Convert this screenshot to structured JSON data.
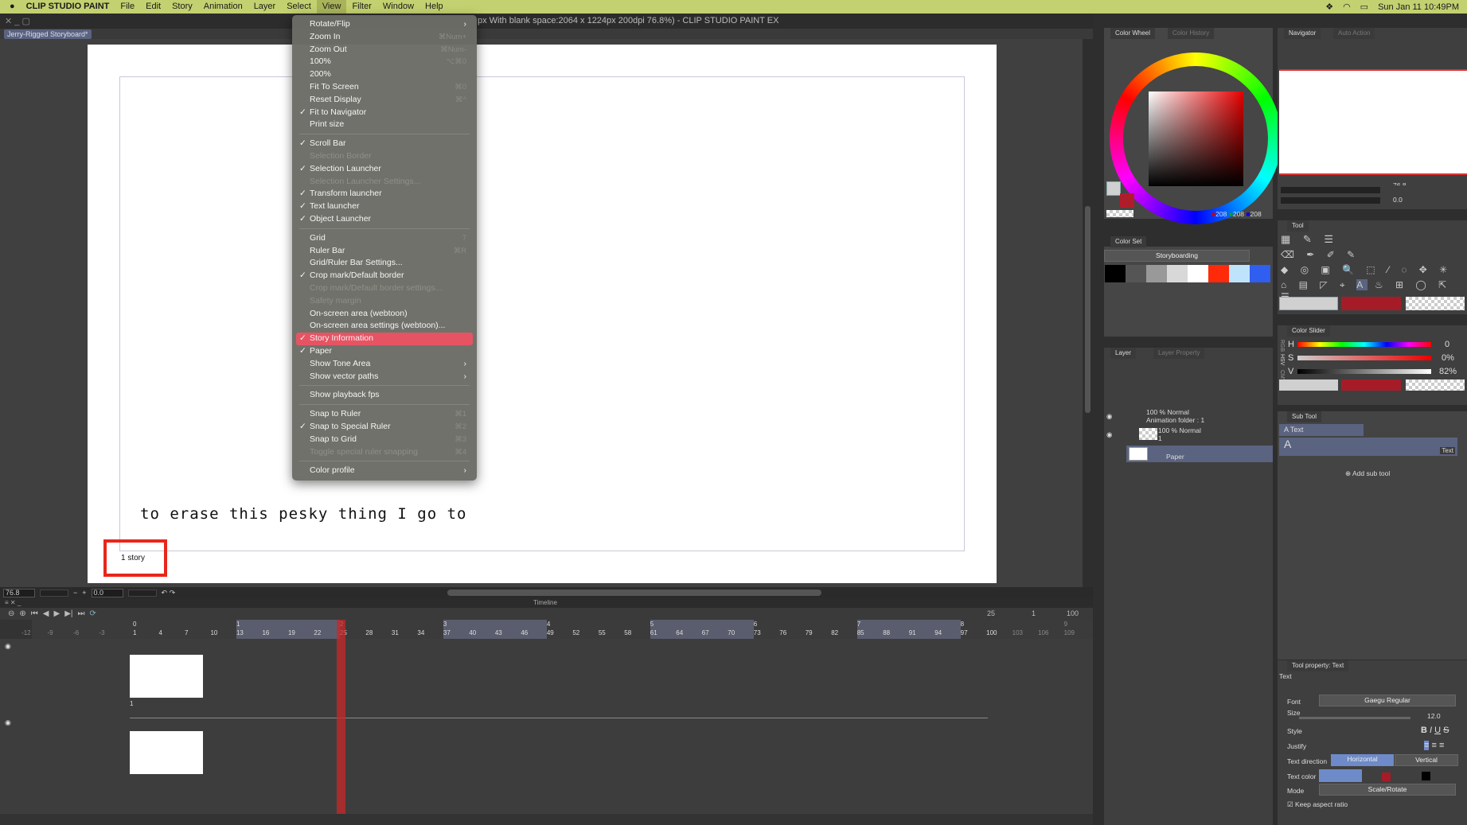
{
  "menubar": {
    "app": "CLIP STUDIO PAINT",
    "items": [
      "File",
      "Edit",
      "Story",
      "Animation",
      "Layer",
      "Select",
      "View",
      "Filter",
      "Window",
      "Help"
    ],
    "active": "View",
    "clock": "Sun Jan 11  10:49PM"
  },
  "window": {
    "title": "px With blank space:2064 x 1224px 200dpi 76.8%)  - CLIP STUDIO PAINT EX",
    "doc_tab": "Jerry-Rigged Storyboard*"
  },
  "canvas": {
    "text": "to erase this pesky thing I go to",
    "story_label": "1 story"
  },
  "status": {
    "zoom": "76.8",
    "angle": "0.0"
  },
  "view_menu": [
    {
      "label": "Rotate/Flip",
      "submenu": true
    },
    {
      "label": "Zoom In",
      "shortcut": "⌘Num+"
    },
    {
      "label": "Zoom Out",
      "shortcut": "⌘Num-"
    },
    {
      "label": "100%",
      "shortcut": "⌥⌘0"
    },
    {
      "label": "200%"
    },
    {
      "label": "Fit To Screen",
      "shortcut": "⌘0"
    },
    {
      "label": "Reset Display",
      "shortcut": "⌘^"
    },
    {
      "label": "Fit to Navigator",
      "checked": true
    },
    {
      "label": "Print size"
    },
    {
      "sep": true
    },
    {
      "label": "Scroll Bar",
      "checked": true
    },
    {
      "label": "Selection Border",
      "disabled": true
    },
    {
      "label": "Selection Launcher",
      "checked": true
    },
    {
      "label": "Selection Launcher Settings...",
      "disabled": true
    },
    {
      "label": "Transform launcher",
      "checked": true
    },
    {
      "label": "Text launcher",
      "checked": true
    },
    {
      "label": "Object Launcher",
      "checked": true
    },
    {
      "sep": true
    },
    {
      "label": "Grid",
      "shortcut": "7"
    },
    {
      "label": "Ruler Bar",
      "shortcut": "⌘R"
    },
    {
      "label": "Grid/Ruler Bar Settings..."
    },
    {
      "label": "Crop mark/Default border",
      "checked": true
    },
    {
      "label": "Crop mark/Default border settings...",
      "disabled": true
    },
    {
      "label": "Safety margin",
      "disabled": true
    },
    {
      "label": "On-screen area (webtoon)"
    },
    {
      "label": "On-screen area settings (webtoon)..."
    },
    {
      "label": "Story Information",
      "checked": true,
      "highlighted": true
    },
    {
      "label": "Paper",
      "checked": true
    },
    {
      "label": "Show Tone Area",
      "submenu": true
    },
    {
      "label": "Show vector paths",
      "submenu": true
    },
    {
      "sep": true
    },
    {
      "label": "Show playback fps"
    },
    {
      "sep": true
    },
    {
      "label": "Snap to Ruler",
      "shortcut": "⌘1"
    },
    {
      "label": "Snap to Special Ruler",
      "checked": true,
      "shortcut": "⌘2"
    },
    {
      "label": "Snap to Grid",
      "shortcut": "⌘3"
    },
    {
      "label": "Toggle special ruler snapping",
      "disabled": true,
      "shortcut": "⌘4"
    },
    {
      "sep": true
    },
    {
      "label": "Color profile",
      "submenu": true
    }
  ],
  "timeline": {
    "title": "Timeline",
    "current": "25",
    "step": "1",
    "end": "100",
    "playhead_frame": 25,
    "frame_labels": [
      "-12",
      "-9",
      "-6",
      "-3",
      "1",
      "4",
      "7",
      "10",
      "13",
      "16",
      "19",
      "22",
      "25",
      "28",
      "31",
      "34",
      "37",
      "40",
      "43",
      "46",
      "49",
      "52",
      "55",
      "58",
      "61",
      "64",
      "67",
      "70",
      "73",
      "76",
      "79",
      "82",
      "85",
      "88",
      "91",
      "94",
      "97",
      "100",
      "103",
      "106",
      "109"
    ],
    "cuts": [
      "0",
      "1",
      "2",
      "3",
      "4",
      "5",
      "6",
      "7",
      "8",
      "9"
    ],
    "track_label": "1"
  },
  "color_wheel": {
    "tab": "Color Wheel",
    "tab2": "Color History",
    "r": "208",
    "g": "208",
    "b": "208"
  },
  "color_set": {
    "tab": "Color Set",
    "set_name": "Storyboarding",
    "swatches": [
      "#000000",
      "#555555",
      "#999999",
      "#d8d8d8",
      "#ffffff",
      "#ff2a0a",
      "#bfe3fb",
      "#2f5ef0"
    ]
  },
  "layer": {
    "tab": "Layer",
    "tab2": "Layer Property",
    "rows": [
      {
        "mode": "100 % Normal",
        "name": "Animation folder : 1"
      },
      {
        "mode": "100 % Normal",
        "name": "1"
      },
      {
        "mode": "",
        "name": "Paper"
      }
    ]
  },
  "navigator": {
    "tab": "Navigator",
    "tab2": "Auto Action",
    "zoom": "76.8",
    "angle": "0.0"
  },
  "tool": {
    "tab": "Tool"
  },
  "color_slider": {
    "tab": "Color Slider",
    "modes": [
      "RGB",
      "HSV",
      "CMY"
    ],
    "h_label": "H",
    "s_label": "S",
    "v_label": "V",
    "h": "0",
    "s": "0%",
    "v": "82%"
  },
  "sub_tool": {
    "tab": "Sub Tool",
    "item": "Text",
    "preview_label": "Text",
    "add": "Add sub tool"
  },
  "tool_property": {
    "tab": "Tool property: Text",
    "name": "Text",
    "font_label": "Font",
    "font": "Gaegu Regular",
    "size_label": "Size",
    "size": "12.0",
    "style_label": "Style",
    "justify_label": "Justify",
    "direction_label": "Text direction",
    "horizontal": "Horizontal",
    "vertical": "Vertical",
    "color_label": "Text color",
    "mode_label": "Mode",
    "mode": "Scale/Rotate",
    "keep_aspect": "Keep aspect ratio"
  },
  "colors": {
    "menubar": "#c4d170",
    "highlight": "#e65464",
    "accent": "#a51c28",
    "selection": "#5a6380"
  }
}
